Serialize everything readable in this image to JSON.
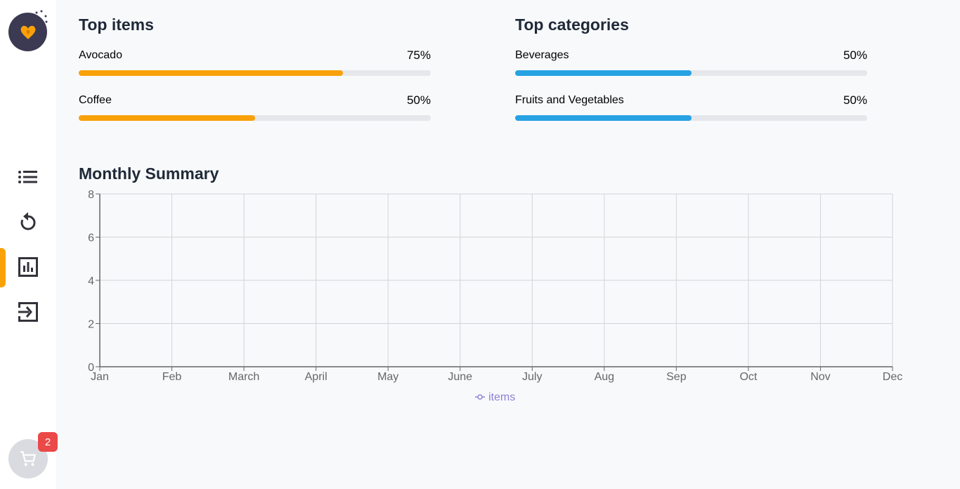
{
  "sidebar": {
    "logo": "heart-logo-icon",
    "nav": [
      {
        "name": "items",
        "icon": "list-icon"
      },
      {
        "name": "history",
        "icon": "history-icon"
      },
      {
        "name": "statistics",
        "icon": "bar-chart-icon",
        "active": true
      },
      {
        "name": "logout",
        "icon": "logout-icon"
      }
    ],
    "cart": {
      "icon": "cart-icon",
      "badge": "2"
    },
    "accent": "#f9a109"
  },
  "top_items": {
    "title": "Top items",
    "color": "#f9a109",
    "items": [
      {
        "name": "Avocado",
        "pct_label": "75%",
        "percent": 75
      },
      {
        "name": "Coffee",
        "pct_label": "50%",
        "percent": 50
      }
    ]
  },
  "top_categories": {
    "title": "Top categories",
    "color": "#27a2e3",
    "items": [
      {
        "name": "Beverages",
        "pct_label": "50%",
        "percent": 50
      },
      {
        "name": "Fruits and Vegetables",
        "pct_label": "50%",
        "percent": 50
      }
    ]
  },
  "monthly": {
    "title": "Monthly Summary"
  },
  "chart_data": {
    "type": "line",
    "title": "",
    "categories": [
      "Jan",
      "Feb",
      "March",
      "April",
      "May",
      "June",
      "July",
      "Aug",
      "Sep",
      "Oct",
      "Nov",
      "Dec"
    ],
    "series": [
      {
        "name": "items",
        "values": []
      }
    ],
    "ylim": [
      0,
      8
    ],
    "yticks": [
      0,
      2,
      4,
      6,
      8
    ],
    "xlabel": "",
    "ylabel": "",
    "grid": true,
    "legend": "bottom-center",
    "series_color": "#8884d8"
  }
}
